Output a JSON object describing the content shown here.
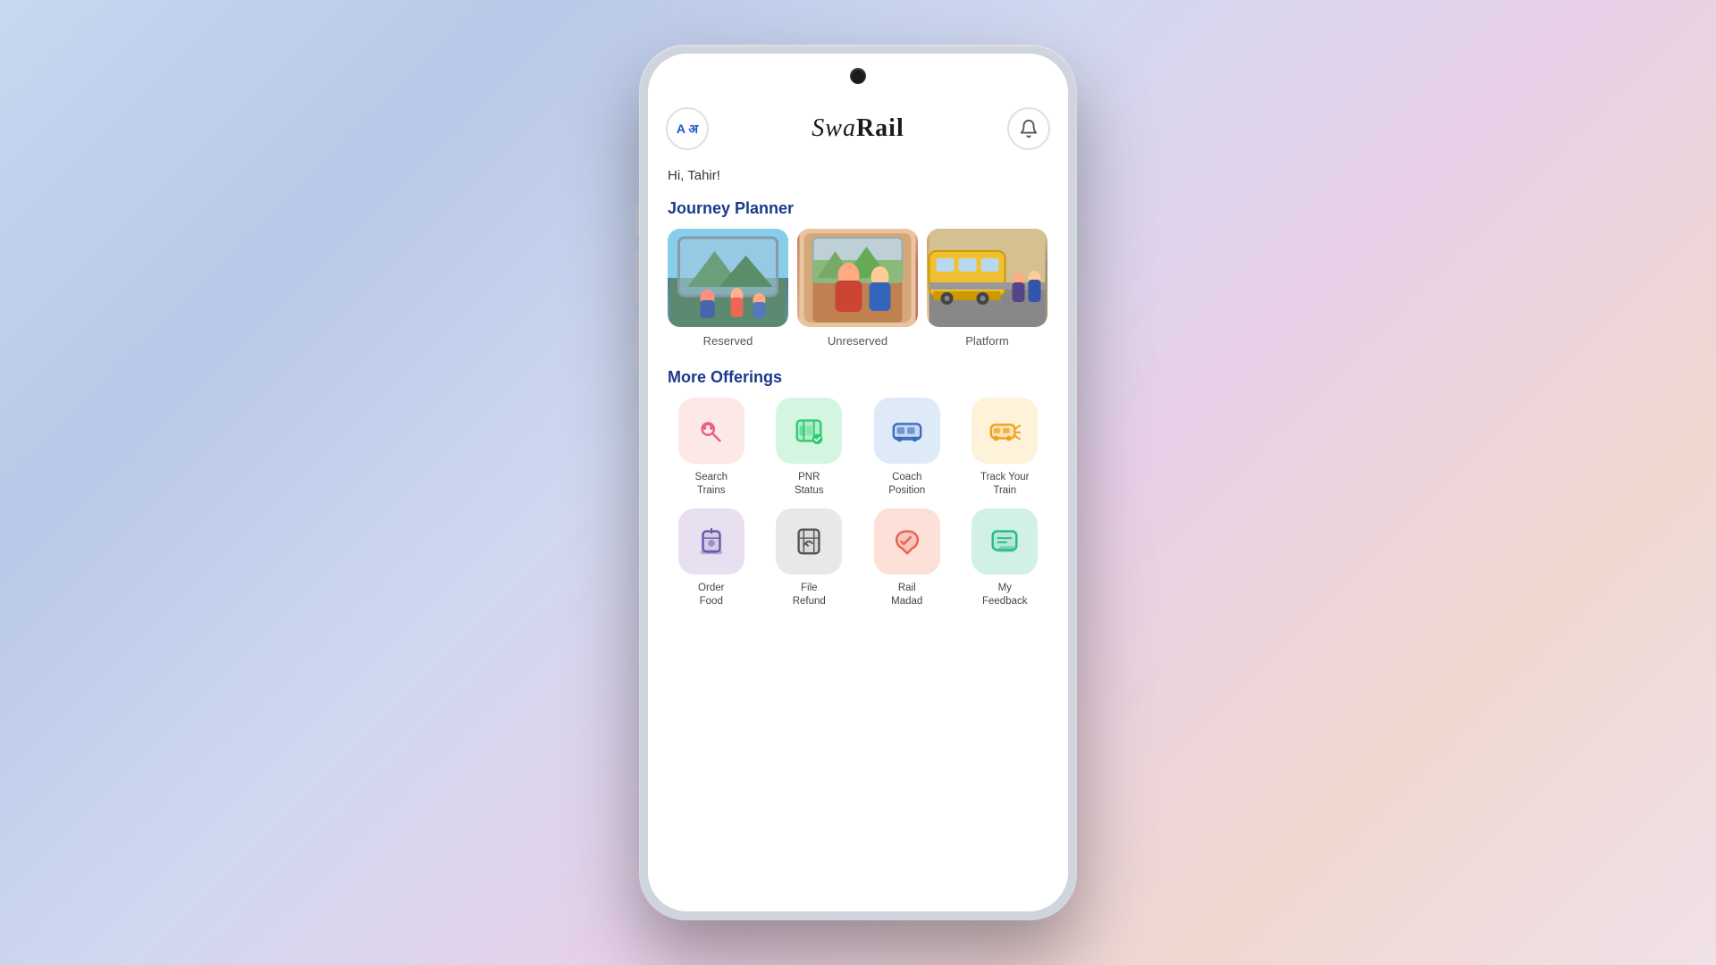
{
  "app": {
    "title": "SwaRail",
    "greeting": "Hi, Tahir!",
    "lang_label": "A अ"
  },
  "journey_planner": {
    "section_title": "Journey Planner",
    "cards": [
      {
        "id": "reserved",
        "label": "Reserved"
      },
      {
        "id": "unreserved",
        "label": "Unreserved"
      },
      {
        "id": "platform",
        "label": "Platform"
      }
    ]
  },
  "more_offerings": {
    "section_title": "More Offerings",
    "items": [
      {
        "id": "search-trains",
        "label": "Search\nTrains",
        "color": "pink"
      },
      {
        "id": "pnr-status",
        "label": "PNR\nStatus",
        "color": "green"
      },
      {
        "id": "coach-position",
        "label": "Coach\nPosition",
        "color": "blue"
      },
      {
        "id": "track-your-train",
        "label": "Track Your\nTrain",
        "color": "yellow"
      },
      {
        "id": "order-food",
        "label": "Order\nFood",
        "color": "purple"
      },
      {
        "id": "file-refund",
        "label": "File\nRefund",
        "color": "gray"
      },
      {
        "id": "rail-madad",
        "label": "Rail\nMadad",
        "color": "salmon"
      },
      {
        "id": "my-feedback",
        "label": "My\nFeedback",
        "color": "teal"
      }
    ]
  }
}
